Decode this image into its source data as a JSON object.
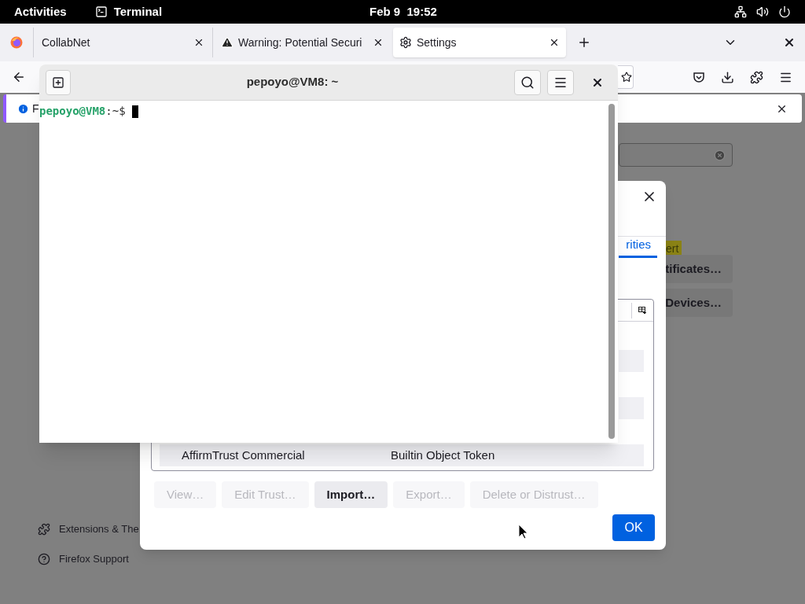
{
  "top_bar": {
    "activities": "Activities",
    "app": "Terminal",
    "clock": "Feb 9  19:52"
  },
  "browser": {
    "tabs": [
      {
        "title": "CollabNet",
        "kind": "plain",
        "selected": false
      },
      {
        "title": "Warning: Potential Securi",
        "kind": "warning",
        "selected": false
      },
      {
        "title": "Settings",
        "kind": "settings",
        "selected": true
      }
    ],
    "notification": {
      "text": "F"
    },
    "page": {
      "highlight": "ert",
      "buttons": [
        "tificates…",
        "Devices…"
      ],
      "footer_links": [
        {
          "label": "Extensions & The",
          "kind": "extensions"
        },
        {
          "label": "Firefox Support",
          "kind": "support"
        }
      ]
    }
  },
  "dialog": {
    "tab": {
      "label": "rities",
      "selected": true
    },
    "row": {
      "name": "AffirmTrust Commercial",
      "device": "Builtin Object Token"
    },
    "buttons": [
      {
        "label": "View…",
        "disabled": true
      },
      {
        "label": "Edit Trust…",
        "disabled": true
      },
      {
        "label": "Import…",
        "disabled": false
      },
      {
        "label": "Export…",
        "disabled": true
      },
      {
        "label": "Delete or Distrust…",
        "disabled": true
      }
    ],
    "ok": "OK"
  },
  "terminal": {
    "title": "pepoyo@VM8: ~",
    "prompt_user": "pepoyo@VM8",
    "prompt_path": ":~$"
  }
}
